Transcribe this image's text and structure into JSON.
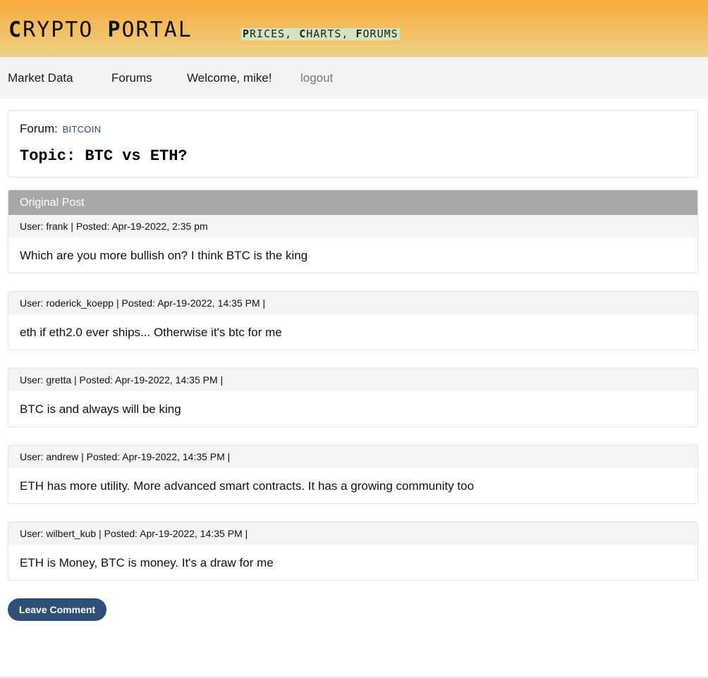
{
  "header": {
    "logo": {
      "w1_initial": "C",
      "w1_rest": "RYPTO",
      "w2_initial": "P",
      "w2_rest": "ORTAL"
    },
    "tagline": {
      "i1": "P",
      "r1": "RICES, ",
      "i2": "C",
      "r2": "HARTS, ",
      "i3": "F",
      "r3": "ORUMS"
    },
    "colors": {
      "gradient_top": "#f8ab3f",
      "gradient_bottom": "#edd189",
      "tagline_bg": "#cfe6c0"
    }
  },
  "nav": {
    "market_data": "Market Data",
    "forums": "Forums",
    "welcome": "Welcome, mike!",
    "logout": "logout"
  },
  "topic": {
    "forum_label": "Forum:",
    "forum_name": "BITCOIN",
    "title": "Topic: BTC vs ETH?"
  },
  "original_post": {
    "banner": "Original Post",
    "meta": "User: frank | Posted: Apr-19-2022, 2:35 pm",
    "body": "Which are you more bullish on? I think BTC is the king"
  },
  "replies": [
    {
      "meta": "User: roderick_koepp | Posted: Apr-19-2022, 14:35 PM |",
      "body": "eth if eth2.0 ever ships... Otherwise it's btc for me"
    },
    {
      "meta": "User: gretta | Posted: Apr-19-2022, 14:35 PM |",
      "body": "BTC is and always will be king"
    },
    {
      "meta": "User: andrew | Posted: Apr-19-2022, 14:35 PM |",
      "body": "ETH has more utility. More advanced smart contracts. It has a growing community too"
    },
    {
      "meta": "User: wilbert_kub | Posted: Apr-19-2022, 14:35 PM |",
      "body": "ETH is Money, BTC is money. It's a draw for me"
    }
  ],
  "actions": {
    "leave_comment": "Leave Comment"
  },
  "theme": {
    "button_bg": "#2e4f77",
    "banner_bg": "#a8a8a8",
    "forum_link": "#2d4d73"
  }
}
